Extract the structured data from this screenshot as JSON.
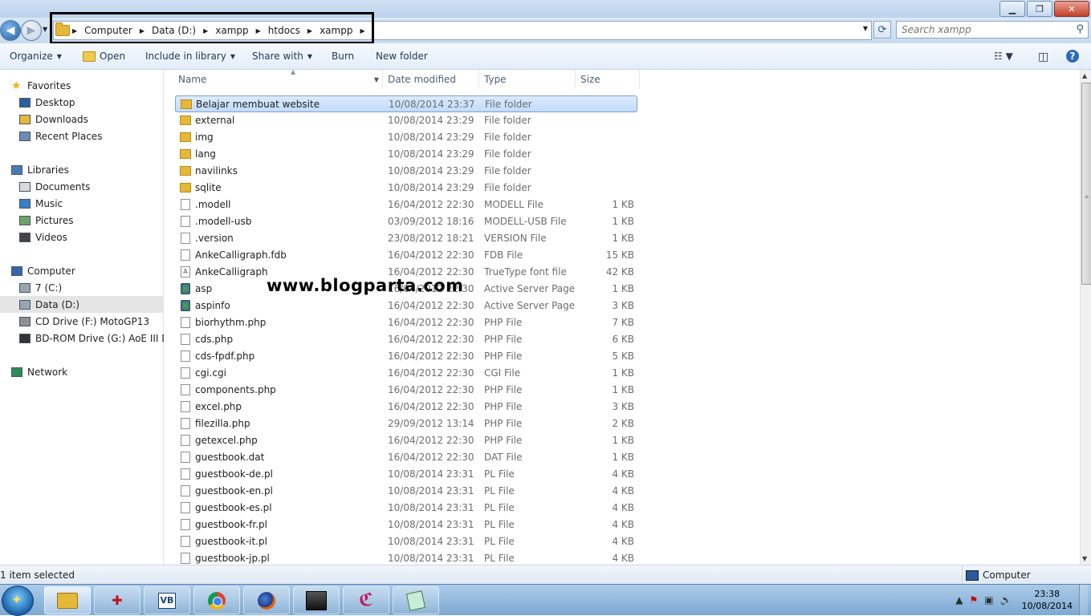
{
  "window": {
    "buttons": {
      "minimize": "▁",
      "maximize": "❐",
      "close": "✕"
    }
  },
  "address": {
    "crumbs": [
      "Computer",
      "Data (D:)",
      "xampp",
      "htdocs",
      "xampp"
    ],
    "search_placeholder": "Search xampp"
  },
  "toolbar": {
    "organize": "Organize",
    "open": "Open",
    "include_library": "Include in library",
    "share_with": "Share with",
    "burn": "Burn",
    "new_folder": "New folder"
  },
  "sidebar": {
    "items": [
      {
        "label": "Favorites",
        "icon": "star-icon",
        "indent": 0
      },
      {
        "label": "Desktop",
        "icon": "desktop-icon",
        "indent": 1
      },
      {
        "label": "Downloads",
        "icon": "downloads-icon",
        "indent": 1
      },
      {
        "label": "Recent Places",
        "icon": "recent-places-icon",
        "indent": 1
      },
      {
        "label": "Libraries",
        "icon": "libraries-icon",
        "indent": 0
      },
      {
        "label": "Documents",
        "icon": "documents-icon",
        "indent": 1
      },
      {
        "label": "Music",
        "icon": "music-icon",
        "indent": 1
      },
      {
        "label": "Pictures",
        "icon": "pictures-icon",
        "indent": 1
      },
      {
        "label": "Videos",
        "icon": "videos-icon",
        "indent": 1
      },
      {
        "label": "Computer",
        "icon": "computer-icon",
        "indent": 0
      },
      {
        "label": "7 (C:)",
        "icon": "drive-icon",
        "indent": 1
      },
      {
        "label": "Data (D:)",
        "icon": "drive-icon",
        "indent": 1,
        "selected": true
      },
      {
        "label": "CD Drive (F:) MotoGP13",
        "icon": "cd-drive-icon",
        "indent": 1
      },
      {
        "label": "BD-ROM Drive (G:) AoE III Disc",
        "icon": "bd-drive-icon",
        "indent": 1
      },
      {
        "label": "Network",
        "icon": "network-icon",
        "indent": 0
      }
    ]
  },
  "columns": {
    "name": "Name",
    "date": "Date modified",
    "type": "Type",
    "size": "Size"
  },
  "files": [
    {
      "name": "Belajar membuat website",
      "date": "10/08/2014 23:37",
      "type": "File folder",
      "size": "",
      "kind": "folder",
      "selected": true
    },
    {
      "name": "external",
      "date": "10/08/2014 23:29",
      "type": "File folder",
      "size": "",
      "kind": "folder"
    },
    {
      "name": "img",
      "date": "10/08/2014 23:29",
      "type": "File folder",
      "size": "",
      "kind": "folder"
    },
    {
      "name": "lang",
      "date": "10/08/2014 23:29",
      "type": "File folder",
      "size": "",
      "kind": "folder"
    },
    {
      "name": "navilinks",
      "date": "10/08/2014 23:29",
      "type": "File folder",
      "size": "",
      "kind": "folder"
    },
    {
      "name": "sqlite",
      "date": "10/08/2014 23:29",
      "type": "File folder",
      "size": "",
      "kind": "folder"
    },
    {
      "name": ".modell",
      "date": "16/04/2012 22:30",
      "type": "MODELL File",
      "size": "1 KB",
      "kind": "file"
    },
    {
      "name": ".modell-usb",
      "date": "03/09/2012 18:16",
      "type": "MODELL-USB File",
      "size": "1 KB",
      "kind": "file"
    },
    {
      "name": ".version",
      "date": "23/08/2012 18:21",
      "type": "VERSION File",
      "size": "1 KB",
      "kind": "file"
    },
    {
      "name": "AnkeCalligraph.fdb",
      "date": "16/04/2012 22:30",
      "type": "FDB File",
      "size": "15 KB",
      "kind": "file"
    },
    {
      "name": "AnkeCalligraph",
      "date": "16/04/2012 22:30",
      "type": "TrueType font file",
      "size": "42 KB",
      "kind": "font"
    },
    {
      "name": "asp",
      "date": "16/04/2012 22:30",
      "type": "Active Server Page",
      "size": "1 KB",
      "kind": "asp"
    },
    {
      "name": "aspinfo",
      "date": "16/04/2012 22:30",
      "type": "Active Server Page",
      "size": "3 KB",
      "kind": "asp"
    },
    {
      "name": "biorhythm.php",
      "date": "16/04/2012 22:30",
      "type": "PHP File",
      "size": "7 KB",
      "kind": "file"
    },
    {
      "name": "cds.php",
      "date": "16/04/2012 22:30",
      "type": "PHP File",
      "size": "6 KB",
      "kind": "file"
    },
    {
      "name": "cds-fpdf.php",
      "date": "16/04/2012 22:30",
      "type": "PHP File",
      "size": "5 KB",
      "kind": "file"
    },
    {
      "name": "cgi.cgi",
      "date": "16/04/2012 22:30",
      "type": "CGI File",
      "size": "1 KB",
      "kind": "file"
    },
    {
      "name": "components.php",
      "date": "16/04/2012 22:30",
      "type": "PHP File",
      "size": "1 KB",
      "kind": "file"
    },
    {
      "name": "excel.php",
      "date": "16/04/2012 22:30",
      "type": "PHP File",
      "size": "3 KB",
      "kind": "file"
    },
    {
      "name": "filezilla.php",
      "date": "29/09/2012 13:14",
      "type": "PHP File",
      "size": "2 KB",
      "kind": "file"
    },
    {
      "name": "getexcel.php",
      "date": "16/04/2012 22:30",
      "type": "PHP File",
      "size": "1 KB",
      "kind": "file"
    },
    {
      "name": "guestbook.dat",
      "date": "16/04/2012 22:30",
      "type": "DAT File",
      "size": "1 KB",
      "kind": "file"
    },
    {
      "name": "guestbook-de.pl",
      "date": "10/08/2014 23:31",
      "type": "PL File",
      "size": "4 KB",
      "kind": "file"
    },
    {
      "name": "guestbook-en.pl",
      "date": "10/08/2014 23:31",
      "type": "PL File",
      "size": "4 KB",
      "kind": "file"
    },
    {
      "name": "guestbook-es.pl",
      "date": "10/08/2014 23:31",
      "type": "PL File",
      "size": "4 KB",
      "kind": "file"
    },
    {
      "name": "guestbook-fr.pl",
      "date": "10/08/2014 23:31",
      "type": "PL File",
      "size": "4 KB",
      "kind": "file"
    },
    {
      "name": "guestbook-it.pl",
      "date": "10/08/2014 23:31",
      "type": "PL File",
      "size": "4 KB",
      "kind": "file"
    },
    {
      "name": "guestbook-jp.pl",
      "date": "10/08/2014 23:31",
      "type": "PL File",
      "size": "4 KB",
      "kind": "file"
    }
  ],
  "watermark": "www.blogparta.com",
  "status": {
    "left": "1 item selected",
    "right": "Computer"
  },
  "taskbar": {
    "apps": [
      "windows-explorer-icon",
      "media-app-icon",
      "virtualbox-icon",
      "chrome-icon",
      "firefox-icon",
      "game-icon",
      "corel-icon",
      "notepad-icon"
    ],
    "time": "23:38",
    "date": "10/08/2014"
  }
}
